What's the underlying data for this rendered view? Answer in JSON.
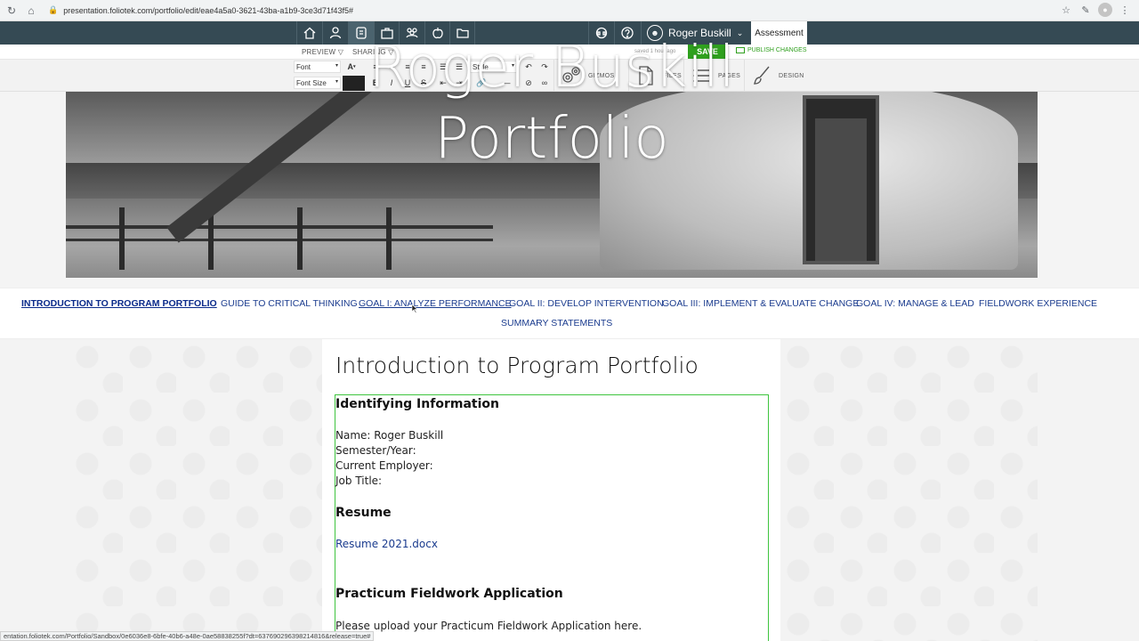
{
  "browser": {
    "url": "presentation.foliotek.com/portfolio/edit/eae4a5a0-3621-43ba-a1b9-3ce3d71f43f5#",
    "status_url": "entation.foliotek.com/Portfolio/Sandbox/0e6036e8-6bfe-40b6-a48e-0ae58838255f?dt=637690296398214816&release=true#"
  },
  "app_nav": {
    "user_name": "Roger Buskill",
    "assessment_label": "Assessment"
  },
  "subbar": {
    "preview_label": "PREVIEW",
    "sharing_label": "SHARING",
    "saved_text": "saved 1 hour ago",
    "save_label": "SAVE",
    "publish_label": "PUBLISH CHANGES"
  },
  "toolbar": {
    "font_label": "Font",
    "font_size_label": "Font Size",
    "style_label": "Style",
    "gizmos_label": "GIZMOS",
    "files_label": "FILES",
    "pages_label": "PAGES",
    "design_label": "DESIGN"
  },
  "hero": {
    "title_line1": "Roger Buskill",
    "title_line2": "Portfolio"
  },
  "page_nav": {
    "items": [
      "INTRODUCTION TO PROGRAM PORTFOLIO",
      "GUIDE TO CRITICAL THINKING",
      "GOAL I: ANALYZE PERFORMANCE",
      "GOAL II: DEVELOP INTERVENTION",
      "GOAL III: IMPLEMENT & EVALUATE CHANGE",
      "GOAL IV: MANAGE & LEAD",
      "FIELDWORK EXPERIENCE",
      "SUMMARY STATEMENTS"
    ]
  },
  "content": {
    "page_title": "Introduction to Program Portfolio",
    "identifying_heading": "Identifying Information",
    "name_line": "Name: Roger Buskill",
    "semester_line": "Semester/Year:",
    "employer_line": "Current Employer:",
    "job_title_line": "Job Title:",
    "resume_heading": "Resume",
    "resume_link": "Resume 2021.docx",
    "practicum_heading": "Practicum Fieldwork Application",
    "practicum_text": "Please upload your Practicum Fieldwork Application here."
  }
}
